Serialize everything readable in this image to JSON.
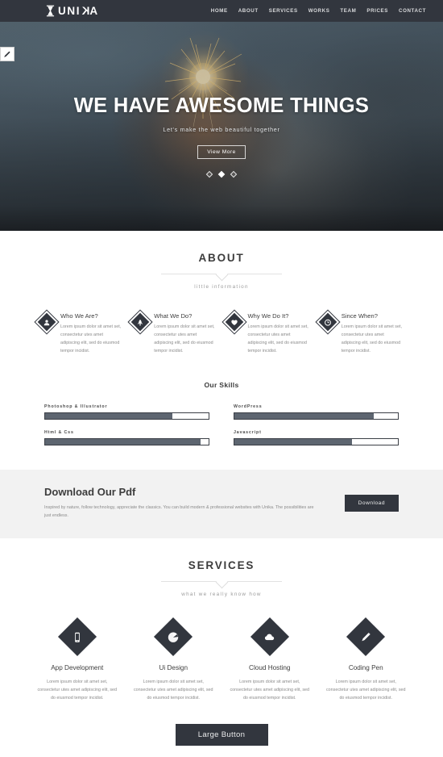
{
  "header": {
    "logo_text_a": "UNI",
    "logo_text_k": "K",
    "logo_text_b": "A",
    "logo_icon": "hourglass-icon",
    "nav": [
      {
        "label": "HOME"
      },
      {
        "label": "ABOUT"
      },
      {
        "label": "SERVICES"
      },
      {
        "label": "WORKS"
      },
      {
        "label": "TEAM"
      },
      {
        "label": "PRICES"
      },
      {
        "label": "CONTACT"
      }
    ],
    "bg_color": "#32363e"
  },
  "edit_tab": {
    "icon": "pencil-icon"
  },
  "hero": {
    "title": "WE HAVE AWESOME THINGS",
    "subtitle": "Let's make the web beautiful together",
    "button_label": "View More",
    "slides": [
      {
        "active": false
      },
      {
        "active": true
      },
      {
        "active": false
      }
    ]
  },
  "about": {
    "title": "ABOUT",
    "subtitle": "little information",
    "cards": [
      {
        "title": "Who We Are?",
        "text": "Lorem ipsum dolor sit amet set, consectetur utes amet adipiscing elit, sed do eiusmod tempor incidist.",
        "icon": "diamond-badge-icon"
      },
      {
        "title": "What We Do?",
        "text": "Lorem ipsum dolor sit amet set, consectetur utes amet adipiscing elit, sed do eiusmod tempor incidist.",
        "icon": "diamond-badge-icon"
      },
      {
        "title": "Why We Do It?",
        "text": "Lorem ipsum dolor sit amet set, consectetur utes amet adipiscing elit, sed do eiusmod tempor incidist.",
        "icon": "diamond-badge-icon"
      },
      {
        "title": "Since When?",
        "text": "Lorem ipsum dolor sit amet set, consectetur utes amet adipiscing elit, sed do eiusmod tempor incidist.",
        "icon": "diamond-badge-icon"
      }
    ]
  },
  "skills": {
    "title": "Our Skills",
    "items": [
      {
        "label": "Photoshop & Illustrator",
        "percent": 78
      },
      {
        "label": "WordPress",
        "percent": 85
      },
      {
        "label": "Html & Css",
        "percent": 95
      },
      {
        "label": "Javascript",
        "percent": 72
      }
    ],
    "fill_color": "#5d6570"
  },
  "download": {
    "title": "Download Our Pdf",
    "text": "Inspired by nature, follow technology, appreciate the classics. You can build modern & professional websites with Unika. The possibilities are just endless.",
    "button_label": "Download"
  },
  "services": {
    "title": "SERVICES",
    "subtitle": "what we really know how",
    "cards": [
      {
        "title": "App Development",
        "text": "Lorem ipsum dolor sit amet set, consectetur utes amet adipiscing elit, sed do eiusmod tempor incidist.",
        "icon": "mobile-phone-icon"
      },
      {
        "title": "Ui Design",
        "text": "Lorem ipsum dolor sit amet set, consectetur utes amet adipiscing elit, sed do eiusmod tempor incidist.",
        "icon": "pie-chart-icon"
      },
      {
        "title": "Cloud Hosting",
        "text": "Lorem ipsum dolor sit amet set, consectetur utes amet adipiscing elit, sed do eiusmod tempor incidist.",
        "icon": "cloud-icon"
      },
      {
        "title": "Coding Pen",
        "text": "Lorem ipsum dolor sit amet set, consectetur utes amet adipiscing elit, sed do eiusmod tempor incidist.",
        "icon": "pen-icon"
      }
    ]
  },
  "footer": {
    "large_button_label": "Large Button"
  }
}
